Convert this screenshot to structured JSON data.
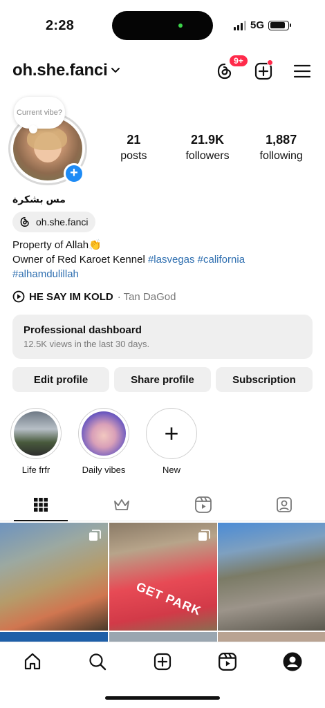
{
  "status_bar": {
    "time": "2:28",
    "network": "5G",
    "battery_fill": 0.85
  },
  "header": {
    "username": "oh.she.fanci",
    "threads_badge": "9+"
  },
  "profile": {
    "note": "Current vibe?",
    "display_name": "مس بشكرة",
    "stats": [
      {
        "value": "21",
        "label": "posts"
      },
      {
        "value": "21.9K",
        "label": "followers"
      },
      {
        "value": "1,887",
        "label": "following"
      }
    ],
    "threads_handle": "oh.she.fanci",
    "bio": {
      "line1": "Property of Allah👏",
      "line2_text": "Owner of Red Karoet Kennel",
      "line2_tags": "#lasvegas #california",
      "line3_tag": "#alhamdulillah"
    },
    "music": {
      "title": "HE SAY IM KOLD",
      "artist": "· Tan DaGod"
    }
  },
  "dashboard": {
    "title": "Professional dashboard",
    "subtitle": "12.5K views in the last 30 days."
  },
  "actions": {
    "edit": "Edit profile",
    "share": "Share profile",
    "subscription": "Subscription"
  },
  "highlights": [
    {
      "label": "Life frfr"
    },
    {
      "label": "Daily vibes"
    },
    {
      "label": "New"
    }
  ],
  "grid": {
    "overlay_text": "GET PARK"
  },
  "colors": {
    "accent": "#1e8bf5",
    "badge": "#ff2a4a",
    "hashtag": "#2f6fb0"
  }
}
